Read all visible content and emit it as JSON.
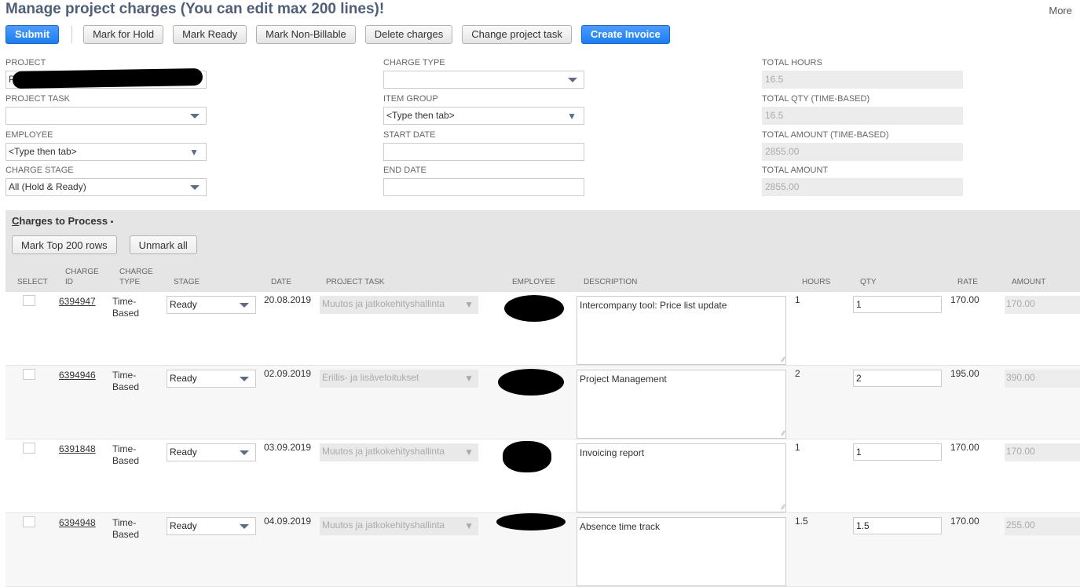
{
  "page": {
    "title": "Manage project charges (You can edit max 200 lines)!",
    "more_label": "More"
  },
  "toolbar": {
    "submit": "Submit",
    "mark_hold": "Mark for Hold",
    "mark_ready": "Mark Ready",
    "mark_non_billable": "Mark Non-Billable",
    "delete_charges": "Delete charges",
    "change_task": "Change project task",
    "create_invoice": "Create Invoice"
  },
  "filters": {
    "project": {
      "label": "PROJECT",
      "value": "P"
    },
    "project_task": {
      "label": "PROJECT TASK",
      "value": ""
    },
    "employee": {
      "label": "EMPLOYEE",
      "value": "<Type then tab>"
    },
    "charge_stage": {
      "label": "CHARGE STAGE",
      "value": "All (Hold & Ready)"
    },
    "charge_type": {
      "label": "CHARGE TYPE",
      "value": ""
    },
    "item_group": {
      "label": "ITEM GROUP",
      "value": "<Type then tab>"
    },
    "start_date": {
      "label": "START DATE",
      "value": ""
    },
    "end_date": {
      "label": "END DATE",
      "value": ""
    }
  },
  "totals": {
    "total_hours": {
      "label": "TOTAL HOURS",
      "value": "16.5"
    },
    "total_qty": {
      "label": "TOTAL QTY (TIME-BASED)",
      "value": "16.5"
    },
    "total_amount_time": {
      "label": "TOTAL AMOUNT (TIME-BASED)",
      "value": "2855.00"
    },
    "total_amount": {
      "label": "TOTAL AMOUNT",
      "value": "2855.00"
    }
  },
  "sublist": {
    "tab_label_first": "C",
    "tab_label_rest": "harges to Process",
    "tab_dot": "•",
    "mark_top": "Mark Top 200 rows",
    "unmark_all": "Unmark all",
    "headers": {
      "select": "SELECT",
      "charge_id_1": "CHARGE",
      "charge_id_2": "ID",
      "charge_type_1": "CHARGE",
      "charge_type_2": "TYPE",
      "stage": "STAGE",
      "date": "DATE",
      "project_task": "PROJECT TASK",
      "employee": "EMPLOYEE",
      "description": "DESCRIPTION",
      "hours": "HOURS",
      "qty": "QTY",
      "rate": "RATE",
      "amount": "AMOUNT"
    },
    "rows": [
      {
        "charge_id": "6394947",
        "type_1": "Time-",
        "type_2": "Based",
        "stage": "Ready",
        "date": "20.08.2019",
        "task": "Muutos ja jatkokehityshallinta",
        "description": "Intercompany tool: Price list update",
        "hours": "1",
        "qty": "1",
        "rate": "170.00",
        "amount": "170.00"
      },
      {
        "charge_id": "6394946",
        "type_1": "Time-",
        "type_2": "Based",
        "stage": "Ready",
        "date": "02.09.2019",
        "task": "Erillis- ja lisäveloitukset",
        "description": "Project Management",
        "hours": "2",
        "qty": "2",
        "rate": "195.00",
        "amount": "390.00"
      },
      {
        "charge_id": "6391848",
        "type_1": "Time-",
        "type_2": "Based",
        "stage": "Ready",
        "date": "03.09.2019",
        "task": "Muutos ja jatkokehityshallinta",
        "description": "Invoicing report",
        "hours": "1",
        "qty": "1",
        "rate": "170.00",
        "amount": "170.00"
      },
      {
        "charge_id": "6394948",
        "type_1": "Time-",
        "type_2": "Based",
        "stage": "Ready",
        "date": "04.09.2019",
        "task": "Muutos ja jatkokehityshallinta",
        "description": "Absence time track",
        "hours": "1.5",
        "qty": "1.5",
        "rate": "170.00",
        "amount": "255.00"
      }
    ]
  }
}
